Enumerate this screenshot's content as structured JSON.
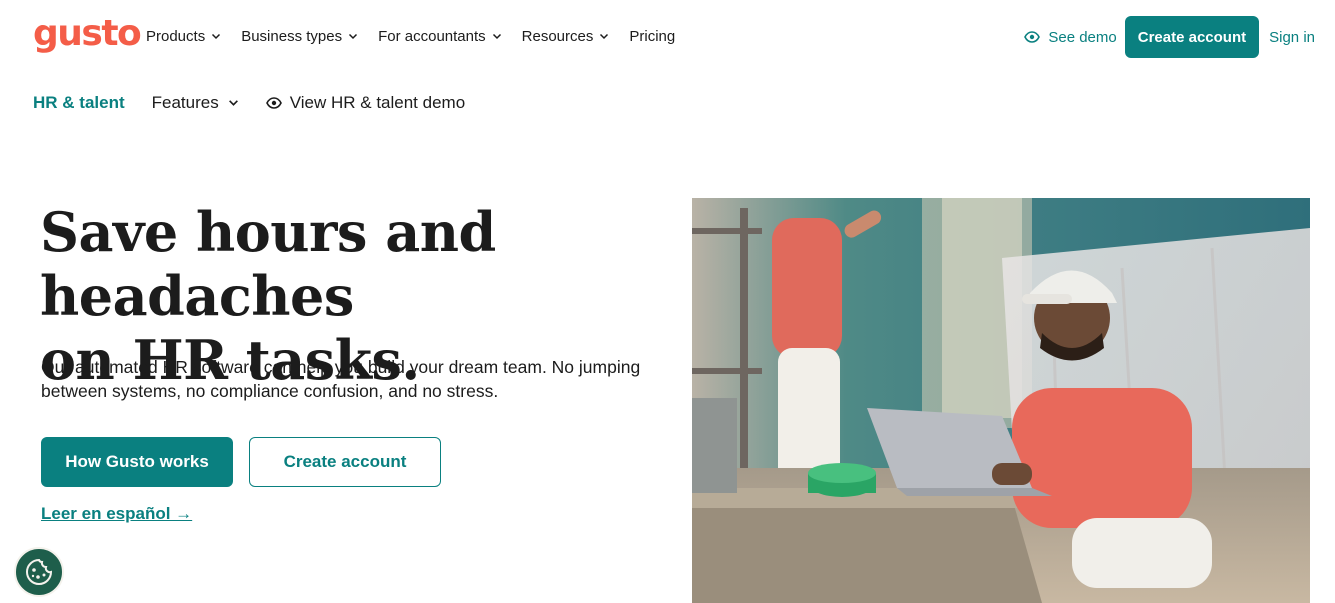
{
  "brand": {
    "logo_text": "gusto",
    "accent": "#0a8080",
    "logo_color": "#f45d48"
  },
  "topnav": {
    "links": [
      {
        "label": "Products",
        "has_dropdown": true
      },
      {
        "label": "Business types",
        "has_dropdown": true
      },
      {
        "label": "For accountants",
        "has_dropdown": true
      },
      {
        "label": "Resources",
        "has_dropdown": true
      },
      {
        "label": "Pricing",
        "has_dropdown": false
      }
    ],
    "see_demo": "See demo",
    "create_account": "Create account",
    "sign_in": "Sign in"
  },
  "subnav": {
    "section": "HR & talent",
    "features": "Features",
    "view_demo": "View HR & talent demo"
  },
  "hero": {
    "headline_line1": "Save hours and headaches",
    "headline_line2": "on HR tasks.",
    "subcopy": "Our automated HR software can help you build your dream team. No jumping between systems, no compliance confusion, and no stress.",
    "primary_button": "How Gusto works",
    "secondary_button": "Create account",
    "spanish_link": "Leer en español →"
  },
  "icons": {
    "see_demo": "eye-icon",
    "view_demo": "eye-icon",
    "dropdown": "chevron-down-icon",
    "cookie": "cookie-icon"
  }
}
